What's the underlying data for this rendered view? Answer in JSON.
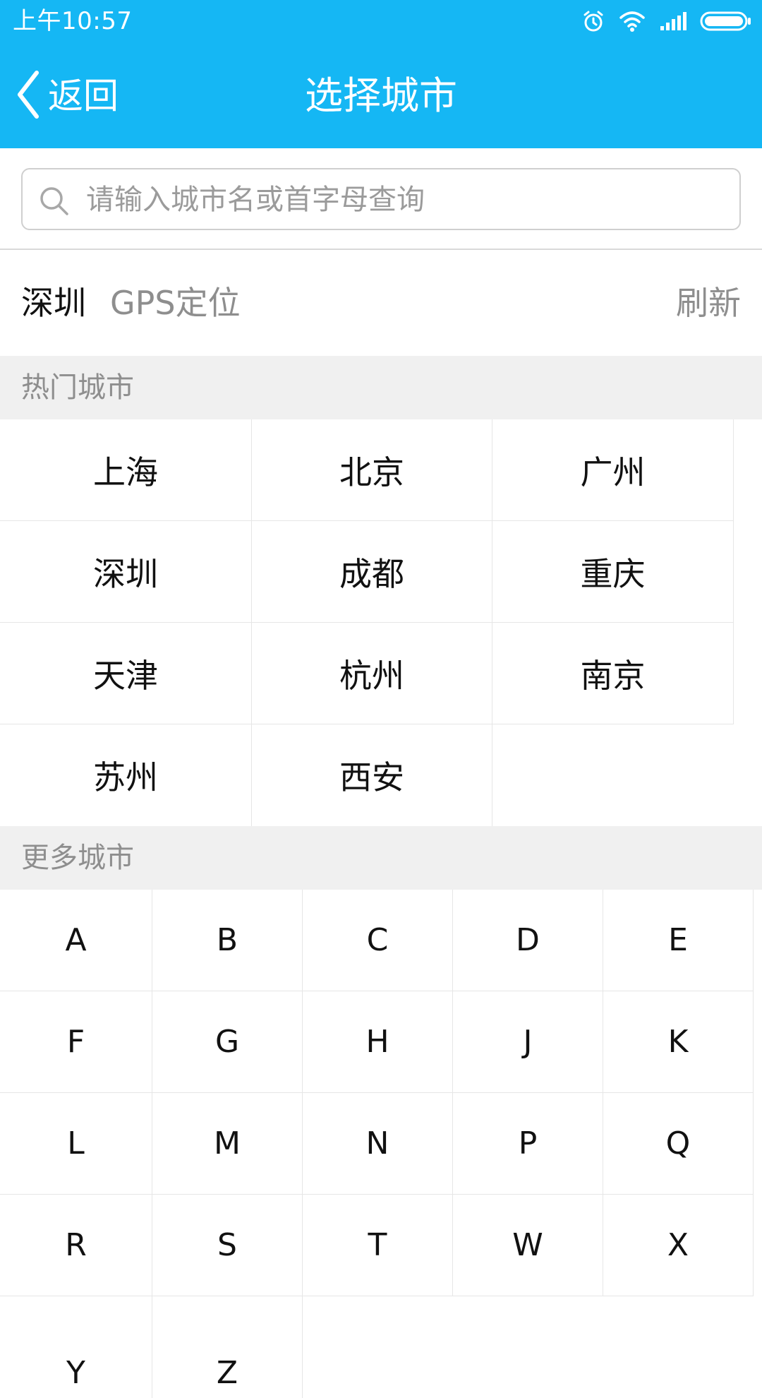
{
  "status_bar": {
    "time": "上午10:57",
    "icons": [
      "alarm-icon",
      "wifi-icon",
      "signal-icon",
      "battery-icon"
    ]
  },
  "nav": {
    "back_label": "返回",
    "title": "选择城市"
  },
  "search": {
    "placeholder": "请输入城市名或首字母查询",
    "value": ""
  },
  "gps": {
    "city": "深圳",
    "label": "GPS定位",
    "refresh_label": "刷新"
  },
  "hot_cities": {
    "header": "热门城市",
    "items": [
      "上海",
      "北京",
      "广州",
      "深圳",
      "成都",
      "重庆",
      "天津",
      "杭州",
      "南京",
      "苏州",
      "西安"
    ]
  },
  "more_cities": {
    "header": "更多城市",
    "letters": [
      "A",
      "B",
      "C",
      "D",
      "E",
      "F",
      "G",
      "H",
      "J",
      "K",
      "L",
      "M",
      "N",
      "P",
      "Q",
      "R",
      "S",
      "T",
      "W",
      "X",
      "Y",
      "Z"
    ]
  },
  "colors": {
    "accent": "#15B7F4",
    "section_bg": "#F0F0F0",
    "muted_text": "#8E8E8E"
  }
}
